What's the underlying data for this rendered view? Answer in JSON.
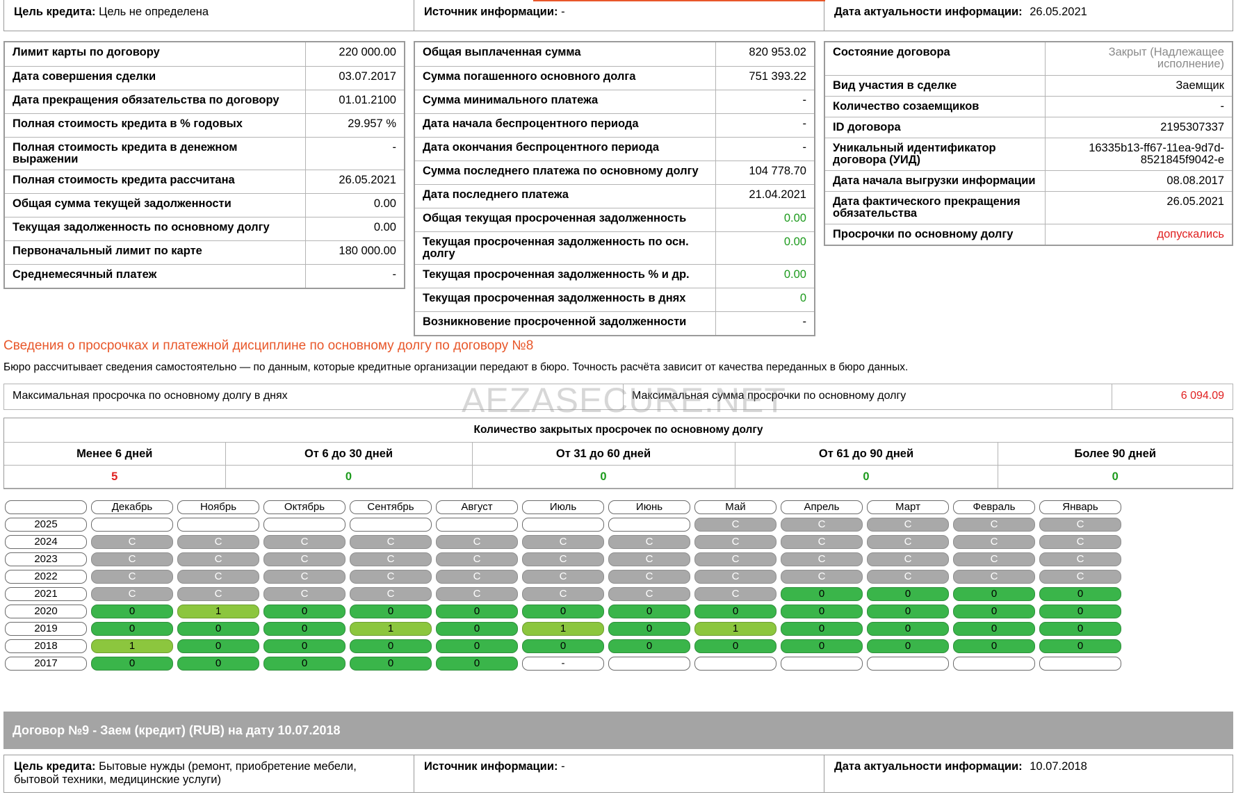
{
  "top_info": {
    "purpose_label": "Цель кредита:",
    "purpose_value": "Цель не определена",
    "source_label": "Источник информации:",
    "source_value": "-",
    "date_label": "Дата актуальности информации:",
    "date_value": "26.05.2021"
  },
  "col1": [
    {
      "label": "Лимит карты по договору",
      "value": "220 000.00"
    },
    {
      "label": "Дата совершения сделки",
      "value": "03.07.2017"
    },
    {
      "label": "Дата прекращения обязательства по договору",
      "value": "01.01.2100"
    },
    {
      "label": "Полная стоимость кредита в % годовых",
      "value": "29.957 %"
    },
    {
      "label": "Полная стоимость кредита в денежном выражении",
      "value": "-"
    },
    {
      "label": "Полная стоимость кредита рассчитана",
      "value": "26.05.2021"
    },
    {
      "label": "Общая сумма текущей задолженности",
      "value": "0.00"
    },
    {
      "label": "Текущая задолженность по основному долгу",
      "value": "0.00"
    },
    {
      "label": "Первоначальный лимит по карте",
      "value": "180 000.00"
    },
    {
      "label": "Среднемесячный платеж",
      "value": "-"
    }
  ],
  "col2": [
    {
      "label": "Общая выплаченная сумма",
      "value": "820 953.02"
    },
    {
      "label": "Сумма погашенного основного долга",
      "value": "751 393.22"
    },
    {
      "label": "Сумма минимального платежа",
      "value": "-"
    },
    {
      "label": "Дата начала беспроцентного периода",
      "value": "-"
    },
    {
      "label": "Дата окончания беспроцентного периода",
      "value": "-"
    },
    {
      "label": "Сумма последнего платежа по основному долгу",
      "value": "104 778.70"
    },
    {
      "label": "Дата последнего платежа",
      "value": "21.04.2021"
    },
    {
      "label": "Общая текущая просроченная задолженность",
      "value": "0.00"
    },
    {
      "label": "Текущая просроченная задолженность по осн. долгу",
      "value": "0.00"
    },
    {
      "label": "Текущая просроченная задолженность % и др.",
      "value": "0.00"
    },
    {
      "label": "Текущая просроченная задолженность в днях",
      "value": "0"
    },
    {
      "label": "Возникновение просроченной задолженности",
      "value": "-"
    }
  ],
  "col3": [
    {
      "label": "Состояние договора",
      "value": "Закрыт  (Надлежащее исполнение)"
    },
    {
      "label": "Вид участия в сделке",
      "value": "Заемщик"
    },
    {
      "label": "Количество созаемщиков",
      "value": "-"
    },
    {
      "label": "ID договора",
      "value": "2195307337"
    },
    {
      "label": "Уникальный идентификатор договора (УИД)",
      "value": "16335b13-ff67-11ea-9d7d-8521845f9042-e"
    },
    {
      "label": "Дата начала выгрузки информации",
      "value": "08.08.2017"
    },
    {
      "label": "Дата фактического прекращения обязательства",
      "value": "26.05.2021"
    },
    {
      "label": "Просрочки по основному долгу",
      "value": "допускались"
    }
  ],
  "section": {
    "title": "Сведения о просрочках и платежной дисциплине по основному долгу по договору №8",
    "note": "Бюро рассчитывает сведения самостоятельно — по данным, которые кредитные организации передают в бюро. Точность расчёта зависит от качества переданных в бюро данных."
  },
  "max_overdue": {
    "days_label": "Максимальная просрочка по основному долгу в днях",
    "days_value": "",
    "sum_label": "Максимальная сумма просрочки по основному долгу",
    "sum_value": "6 094.09"
  },
  "watermark": "AEZASECURE.NET",
  "closed_overdue": {
    "title": "Количество закрытых просрочек по основному долгу",
    "headers": [
      "Менее 6 дней",
      "От 6 до 30 дней",
      "От 31 до 60 дней",
      "От 61 до 90 дней",
      "Более 90 дней"
    ],
    "values": [
      "5",
      "0",
      "0",
      "0",
      "0"
    ],
    "value_colors": [
      "#e02020",
      "#1c9a1c",
      "#1c9a1c",
      "#1c9a1c",
      "#1c9a1c"
    ]
  },
  "calendar": {
    "months": [
      "Декабрь",
      "Ноябрь",
      "Октябрь",
      "Сентябрь",
      "Август",
      "Июль",
      "Июнь",
      "Май",
      "Апрель",
      "Март",
      "Февраль",
      "Январь"
    ],
    "legend": {
      "C": "closed-grey",
      "0": "green",
      "1": "light-green",
      "-": "empty",
      "": "empty"
    },
    "rows": [
      {
        "year": "2025",
        "cells": [
          "",
          "",
          "",
          "",
          "",
          "",
          "",
          "C",
          "C",
          "C",
          "C",
          "C"
        ]
      },
      {
        "year": "2024",
        "cells": [
          "C",
          "C",
          "C",
          "C",
          "C",
          "C",
          "C",
          "C",
          "C",
          "C",
          "C",
          "C"
        ]
      },
      {
        "year": "2023",
        "cells": [
          "C",
          "C",
          "C",
          "C",
          "C",
          "C",
          "C",
          "C",
          "C",
          "C",
          "C",
          "C"
        ]
      },
      {
        "year": "2022",
        "cells": [
          "C",
          "C",
          "C",
          "C",
          "C",
          "C",
          "C",
          "C",
          "C",
          "C",
          "C",
          "C"
        ]
      },
      {
        "year": "2021",
        "cells": [
          "C",
          "C",
          "C",
          "C",
          "C",
          "C",
          "C",
          "C",
          "0",
          "0",
          "0",
          "0"
        ]
      },
      {
        "year": "2020",
        "cells": [
          "0",
          "1",
          "0",
          "0",
          "0",
          "0",
          "0",
          "0",
          "0",
          "0",
          "0",
          "0"
        ]
      },
      {
        "year": "2019",
        "cells": [
          "0",
          "0",
          "0",
          "1",
          "0",
          "1",
          "0",
          "1",
          "0",
          "0",
          "0",
          "0"
        ]
      },
      {
        "year": "2018",
        "cells": [
          "1",
          "0",
          "0",
          "0",
          "0",
          "0",
          "0",
          "0",
          "0",
          "0",
          "0",
          "0"
        ]
      },
      {
        "year": "2017",
        "cells": [
          "0",
          "0",
          "0",
          "0",
          "0",
          "-",
          "",
          "",
          "",
          "",
          "",
          ""
        ]
      }
    ],
    "colors": {
      "grey": "#a9a9a9",
      "green": "#3ab54a",
      "light_green": "#8cc63e"
    }
  },
  "contract9": {
    "header": "Договор №9 - Заем (кредит) (RUB)  на дату 10.07.2018",
    "purpose_label": "Цель кредита:",
    "purpose_value": "Бытовые нужды (ремонт, приобретение мебели, бытовой техники, медицинские услуги)",
    "source_label": "Источник информации:",
    "source_value": "-",
    "date_label": "Дата актуальности информации:",
    "date_value": "10.07.2018"
  }
}
